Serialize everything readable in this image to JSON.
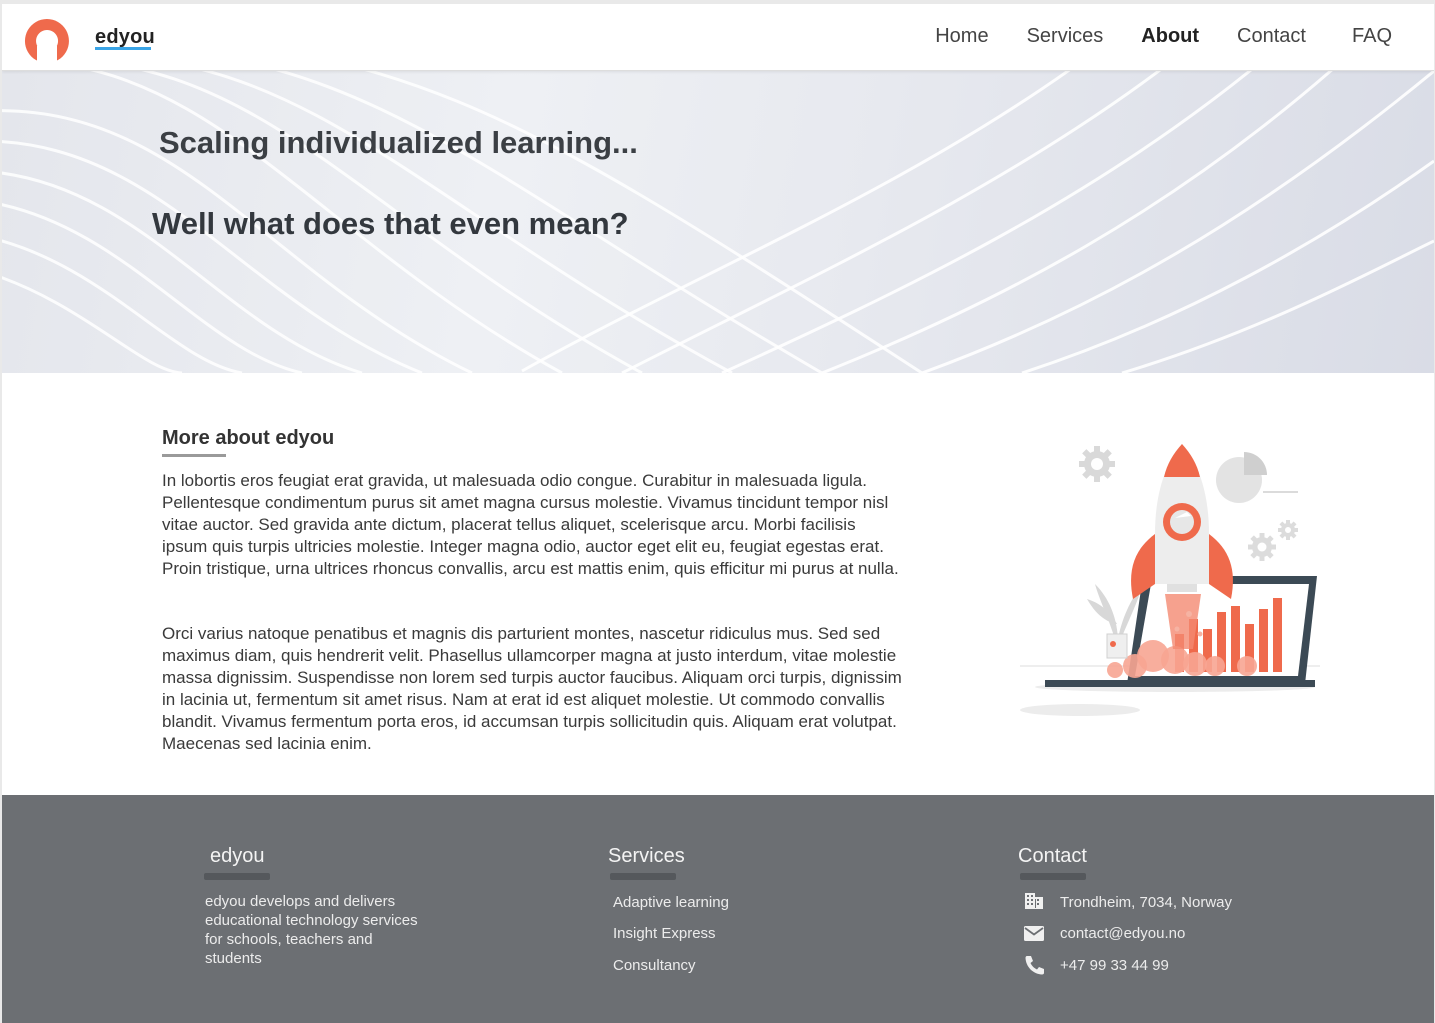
{
  "brand": {
    "name": "edyou",
    "accent": "#ef6a4c",
    "underline": "#3aa4e6"
  },
  "nav": {
    "items": [
      {
        "label": "Home",
        "active": false
      },
      {
        "label": "Services",
        "active": false
      },
      {
        "label": "About",
        "active": true
      },
      {
        "label": "Contact",
        "active": false
      },
      {
        "label": "FAQ",
        "active": false
      }
    ]
  },
  "hero": {
    "line1": "Scaling individualized learning...",
    "line2": "Well what does that even mean?"
  },
  "about": {
    "title": "More about edyou",
    "paragraph1": "In lobortis eros feugiat erat gravida, ut malesuada odio congue. Curabitur in malesuada ligula. Pellentesque condimentum purus sit amet magna cursus molestie. Vivamus tincidunt tempor nisl vitae auctor. Sed gravida ante dictum, placerat tellus aliquet, scelerisque arcu. Morbi facilisis ipsum quis turpis ultricies molestie. Integer magna odio, auctor eget elit eu, feugiat egestas erat. Proin tristique, urna ultrices rhoncus convallis, arcu est mattis enim, quis efficitur mi purus at nulla.",
    "paragraph2": "Orci varius natoque penatibus et magnis dis parturient montes, nascetur ridiculus mus. Sed sed maximus diam, quis hendrerit velit. Phasellus ullamcorper magna at justo interdum, vitae molestie massa dignissim. Suspendisse non lorem sed turpis auctor faucibus. Aliquam orci turpis, dignissim in lacinia ut, fermentum sit amet risus. Nam at erat id est aliquet molestie. Ut commodo convallis blandit. Vivamus fermentum porta eros, id accumsan turpis sollicitudin quis. Aliquam erat volutpat. Maecenas sed lacinia enim.",
    "illustration": "rocket-launch-laptop-illustration"
  },
  "footer": {
    "about": {
      "title": "edyou",
      "text": "edyou develops and delivers educational technology services for schools, teachers and students"
    },
    "services": {
      "title": "Services",
      "items": [
        "Adaptive learning",
        "Insight Express",
        "Consultancy"
      ]
    },
    "contact": {
      "title": "Contact",
      "address": "Trondheim, 7034, Norway",
      "email": "contact@edyou.no",
      "phone": "+47 99 33 44 99",
      "icons": [
        "building-icon",
        "mail-icon",
        "phone-icon"
      ]
    }
  }
}
